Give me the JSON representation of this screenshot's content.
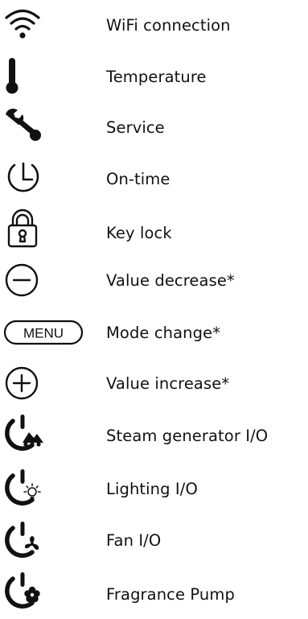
{
  "legend": {
    "items": [
      {
        "icon": "wifi-icon",
        "label": "WiFi connection"
      },
      {
        "icon": "thermometer-icon",
        "label": "Temperature"
      },
      {
        "icon": "wrench-icon",
        "label": "Service"
      },
      {
        "icon": "clock-icon",
        "label": "On-time"
      },
      {
        "icon": "padlock-icon",
        "label": "Key lock"
      },
      {
        "icon": "minus-circle-icon",
        "label": "Value decrease*"
      },
      {
        "icon": "menu-button-icon",
        "label": "Mode change*",
        "icon_text": "MENU"
      },
      {
        "icon": "plus-circle-icon",
        "label": "Value increase*"
      },
      {
        "icon": "power-steam-icon",
        "label": "Steam generator I/O"
      },
      {
        "icon": "power-light-icon",
        "label": "Lighting I/O"
      },
      {
        "icon": "power-fan-icon",
        "label": "Fan I/O"
      },
      {
        "icon": "power-fragrance-icon",
        "label": "Fragrance Pump"
      }
    ]
  }
}
